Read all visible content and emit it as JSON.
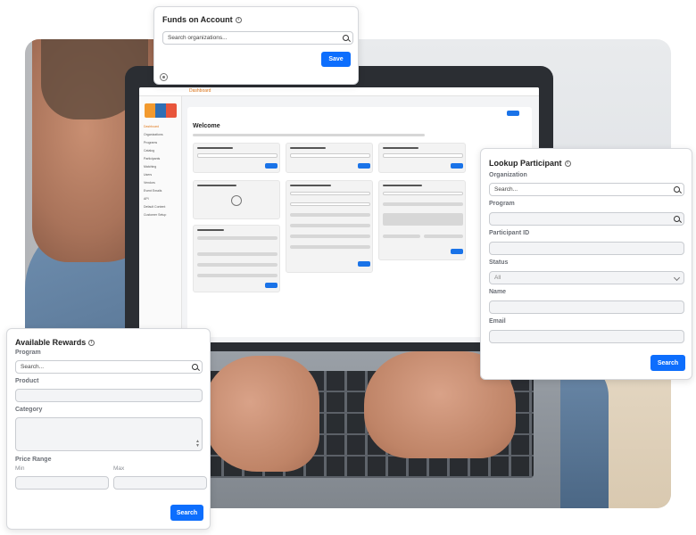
{
  "funds_card": {
    "title": "Funds on Account",
    "search_placeholder": "Search organizations...",
    "save_label": "Save"
  },
  "lookup_card": {
    "title": "Lookup Participant",
    "organization_label": "Organization",
    "organization_placeholder": "Search...",
    "program_label": "Program",
    "participant_id_label": "Participant ID",
    "status_label": "Status",
    "status_value": "All",
    "name_label": "Name",
    "email_label": "Email",
    "search_label": "Search"
  },
  "rewards_card": {
    "title": "Available Rewards",
    "program_label": "Program",
    "program_placeholder": "Search...",
    "product_label": "Product",
    "category_label": "Category",
    "price_range_label": "Price Range",
    "min_label": "Min",
    "max_label": "Max",
    "search_label": "Search"
  },
  "laptop_screen": {
    "logo": "adr",
    "breadcrumb": "Dashboard",
    "welcome_title": "Welcome",
    "sidebar_items": [
      "Dashboard",
      "Organizations",
      "Programs",
      "Catalog",
      "Participants",
      "Matching",
      "Users",
      "Vendors",
      "Event Emails",
      "API",
      "Default Content",
      "Customer Setup"
    ],
    "card_titles": [
      "Funds on Account",
      "Funds on Account",
      "Funds on Account",
      "Create Participant",
      "Lookup Participant",
      "Available Rewards",
      "Modify Case"
    ]
  }
}
